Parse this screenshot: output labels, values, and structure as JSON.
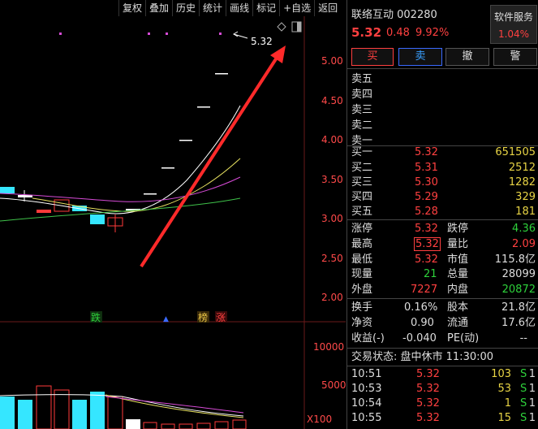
{
  "toolbar": {
    "items": [
      "复权",
      "叠加",
      "历史",
      "统计",
      "画线",
      "标记",
      "+自选",
      "返回"
    ]
  },
  "chart": {
    "price_label": "5.32",
    "markers": {
      "down": "跌",
      "up_arrow": "▲",
      "bang": "榜",
      "rise": "涨"
    },
    "price_axis": [
      "5.00",
      "4.50",
      "4.00",
      "3.50",
      "3.00",
      "2.50",
      "2.00"
    ],
    "volume_axis": [
      "10000",
      "5000"
    ],
    "volume_unit": "X100",
    "colors": {
      "up": "#ff3a3a",
      "down": "#35e6ff",
      "ma_white": "#ffffff",
      "ma_yellow": "#e6e060",
      "ma_purple": "#d64bd6",
      "ma_green": "#3fc24a",
      "arrow": "#ff2a2a"
    },
    "icons": [
      "diamond-icon",
      "panel-icon"
    ]
  },
  "stock": {
    "name_code": "联络互动 002280",
    "price": "5.32",
    "change": "0.48",
    "pct": "9.92%"
  },
  "service": {
    "label": "软件服务",
    "value": "1.04%"
  },
  "actions": [
    "买",
    "卖",
    "撤",
    "警"
  ],
  "asks": [
    {
      "label": "卖五"
    },
    {
      "label": "卖四"
    },
    {
      "label": "卖三"
    },
    {
      "label": "卖二"
    },
    {
      "label": "卖一"
    }
  ],
  "bids": [
    {
      "label": "买一",
      "price": "5.32",
      "vol": "651505"
    },
    {
      "label": "买二",
      "price": "5.31",
      "vol": "2512"
    },
    {
      "label": "买三",
      "price": "5.30",
      "vol": "1282"
    },
    {
      "label": "买四",
      "price": "5.29",
      "vol": "329"
    },
    {
      "label": "买五",
      "price": "5.28",
      "vol": "181"
    }
  ],
  "stats": [
    {
      "l1": "涨停",
      "v1": "5.32",
      "l2": "跌停",
      "v2": "4.36"
    },
    {
      "l1": "最高",
      "v1": "5.32",
      "l2": "量比",
      "v2": "2.09"
    },
    {
      "l1": "最低",
      "v1": "5.32",
      "l2": "市值",
      "v2": "115.8亿"
    },
    {
      "l1": "现量",
      "v1": "21",
      "l2": "总量",
      "v2": "28099"
    },
    {
      "l1": "外盘",
      "v1": "7227",
      "l2": "内盘",
      "v2": "20872"
    }
  ],
  "stats2": [
    {
      "l1": "换手",
      "v1": "0.16%",
      "l2": "股本",
      "v2": "21.8亿"
    },
    {
      "l1": "净资",
      "v1": "0.90",
      "l2": "流通",
      "v2": "17.6亿"
    },
    {
      "l1": "收益(-)",
      "v1": "-0.040",
      "l2": "PE(动)",
      "v2": "--"
    }
  ],
  "trade_status": "交易状态: 盘中休市 11:30:00",
  "ticks": [
    {
      "time": "10:51",
      "price": "5.32",
      "vol": "103",
      "side": "S",
      "n": "1"
    },
    {
      "time": "10:53",
      "price": "5.32",
      "vol": "53",
      "side": "S",
      "n": "1"
    },
    {
      "time": "10:54",
      "price": "5.32",
      "vol": "1",
      "side": "S",
      "n": "1"
    },
    {
      "time": "10:55",
      "price": "5.32",
      "vol": "15",
      "side": "S",
      "n": "1"
    }
  ]
}
